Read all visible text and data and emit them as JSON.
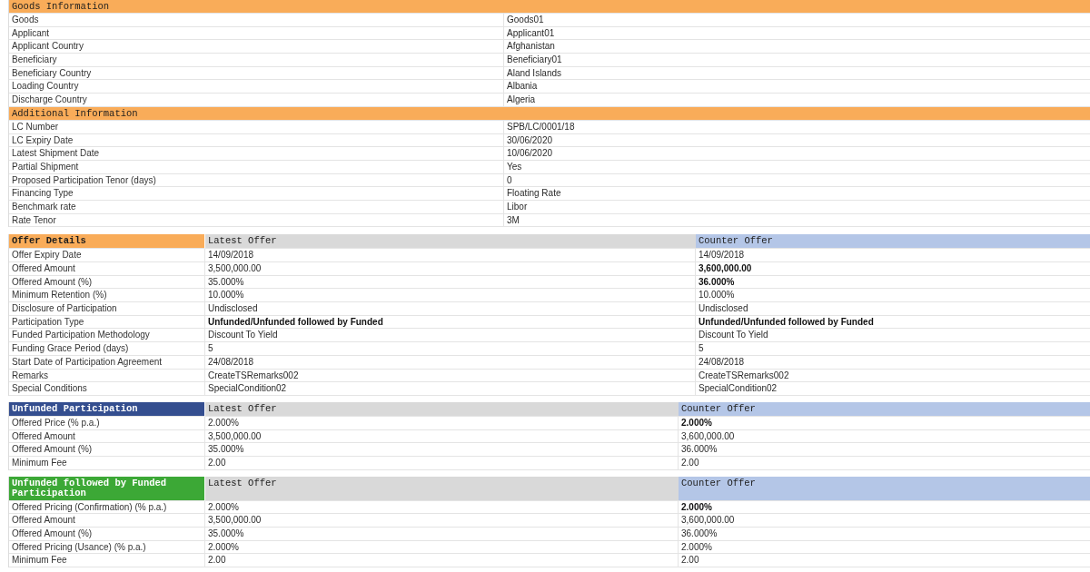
{
  "info_sections": [
    {
      "title": "Goods Information",
      "rows": [
        {
          "label": "Goods",
          "value": "Goods01"
        },
        {
          "label": "Applicant",
          "value": "Applicant01"
        },
        {
          "label": "Applicant Country",
          "value": "Afghanistan"
        },
        {
          "label": "Beneficiary",
          "value": "Beneficiary01"
        },
        {
          "label": "Beneficiary Country",
          "value": "Aland Islands"
        },
        {
          "label": "Loading Country",
          "value": "Albania"
        },
        {
          "label": "Discharge Country",
          "value": "Algeria"
        }
      ]
    },
    {
      "title": "Additional Information",
      "rows": [
        {
          "label": "LC Number",
          "value": "SPB/LC/0001/18"
        },
        {
          "label": "LC Expiry Date",
          "value": "30/06/2020"
        },
        {
          "label": "Latest Shipment Date",
          "value": "10/06/2020"
        },
        {
          "label": "Partial Shipment",
          "value": "Yes"
        },
        {
          "label": "Proposed Participation Tenor (days)",
          "value": "0"
        },
        {
          "label": "Financing Type",
          "value": "Floating Rate"
        },
        {
          "label": "Benchmark rate",
          "value": "Libor"
        },
        {
          "label": "Rate Tenor",
          "value": "3M"
        }
      ]
    }
  ],
  "offer_tables": [
    {
      "title": "Offer Details",
      "color": "#f9ac59",
      "columns": [
        "Latest Offer",
        "Counter Offer"
      ],
      "rows": [
        {
          "label": "Offer Expiry Date",
          "latest": "14/09/2018",
          "counter": "14/09/2018",
          "latest_bold": false,
          "counter_bold": false
        },
        {
          "label": "Offered Amount",
          "latest": "3,500,000.00",
          "counter": "3,600,000.00",
          "latest_bold": false,
          "counter_bold": true
        },
        {
          "label": "Offered Amount (%)",
          "latest": "35.000%",
          "counter": "36.000%",
          "latest_bold": false,
          "counter_bold": true
        },
        {
          "label": "Minimum Retention (%)",
          "latest": "10.000%",
          "counter": "10.000%",
          "latest_bold": false,
          "counter_bold": false
        },
        {
          "label": "Disclosure of Participation",
          "latest": "Undisclosed",
          "counter": "Undisclosed",
          "latest_bold": false,
          "counter_bold": false
        },
        {
          "label": "Participation Type",
          "latest": "Unfunded/Unfunded followed by Funded",
          "counter": "Unfunded/Unfunded followed by Funded",
          "latest_bold": true,
          "counter_bold": true
        },
        {
          "label": "Funded Participation Methodology",
          "latest": "Discount To Yield",
          "counter": "Discount To Yield",
          "latest_bold": false,
          "counter_bold": false
        },
        {
          "label": "Funding Grace Period (days)",
          "latest": "5",
          "counter": "5",
          "latest_bold": false,
          "counter_bold": false
        },
        {
          "label": "Start Date of Participation Agreement",
          "latest": "24/08/2018",
          "counter": "24/08/2018",
          "latest_bold": false,
          "counter_bold": false
        },
        {
          "label": "Remarks",
          "latest": "CreateTSRemarks002",
          "counter": "CreateTSRemarks002",
          "latest_bold": false,
          "counter_bold": false
        },
        {
          "label": "Special Conditions",
          "latest": "SpecialCondition02",
          "counter": "SpecialCondition02",
          "latest_bold": false,
          "counter_bold": false
        }
      ]
    },
    {
      "title": "Unfunded Participation",
      "color": "#344e8f",
      "columns": [
        "Latest Offer",
        "Counter Offer"
      ],
      "rows": [
        {
          "label": "Offered Price (% p.a.)",
          "latest": "2.000%",
          "counter": "2.000%",
          "latest_bold": false,
          "counter_bold": true
        },
        {
          "label": "Offered Amount",
          "latest": "3,500,000.00",
          "counter": "3,600,000.00",
          "latest_bold": false,
          "counter_bold": false
        },
        {
          "label": "Offered Amount (%)",
          "latest": "35.000%",
          "counter": "36.000%",
          "latest_bold": false,
          "counter_bold": false
        },
        {
          "label": "Minimum Fee",
          "latest": "2.00",
          "counter": "2.00",
          "latest_bold": false,
          "counter_bold": false
        }
      ]
    },
    {
      "title": "Unfunded followed by Funded Participation",
      "color": "#3ca836",
      "columns": [
        "Latest Offer",
        "Counter Offer"
      ],
      "rows": [
        {
          "label": "Offered Pricing (Confirmation) (% p.a.)",
          "latest": "2.000%",
          "counter": "2.000%",
          "latest_bold": false,
          "counter_bold": true
        },
        {
          "label": "Offered Amount",
          "latest": "3,500,000.00",
          "counter": "3,600,000.00",
          "latest_bold": false,
          "counter_bold": false
        },
        {
          "label": "Offered Amount (%)",
          "latest": "35.000%",
          "counter": "36.000%",
          "latest_bold": false,
          "counter_bold": false
        },
        {
          "label": "Offered Pricing (Usance) (% p.a.)",
          "latest": "2.000%",
          "counter": "2.000%",
          "latest_bold": false,
          "counter_bold": false
        },
        {
          "label": "Minimum Fee",
          "latest": "2.00",
          "counter": "2.00",
          "latest_bold": false,
          "counter_bold": false
        }
      ]
    }
  ]
}
